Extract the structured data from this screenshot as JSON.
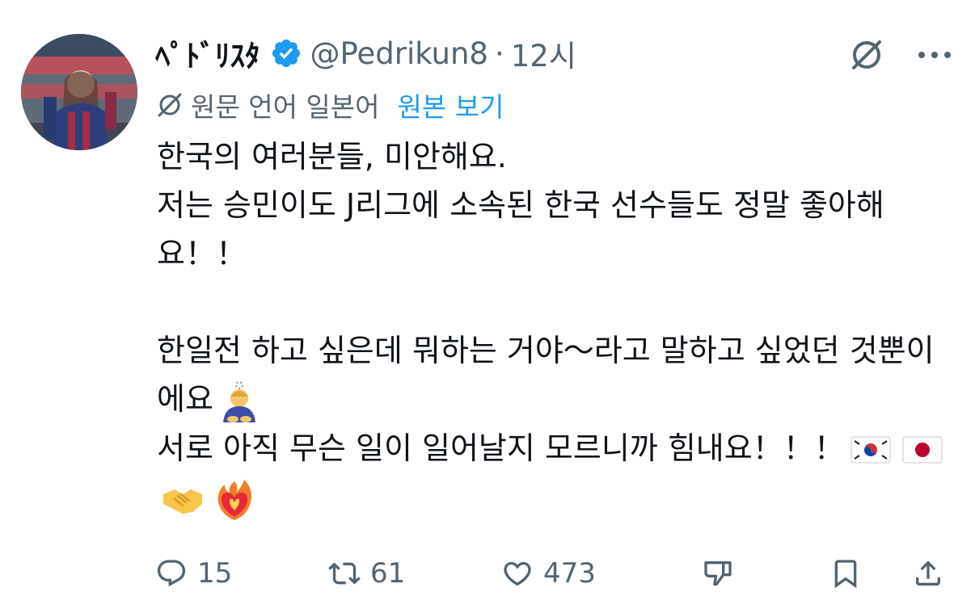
{
  "author": {
    "display_name": "ﾍﾟﾄﾞﾘｽﾀ",
    "handle": "@Pedrikun8",
    "separator": "·",
    "time": "12시",
    "verified": true
  },
  "header_icons": [
    "grok-icon",
    "more-icon"
  ],
  "translation": {
    "notice": "원문 언어 일본어",
    "show_original": "원본 보기"
  },
  "tweet": {
    "line1": "한국의 여러분들, 미안해요.",
    "line2": "저는 승민이도 J리그에 소속된 한국 선수들도 정말 좋아해요！！",
    "line3": "한일전 하고 싶은데 뭐하는 거야～라고 말하고 싶었던 것뿐이에요",
    "line4": "서로 아직 무슨 일이 일어날지 모르니까 힘내요！！！",
    "emojis_line3": [
      "person-bowing-emoji"
    ],
    "emojis_line4": [
      "flag-korea-emoji",
      "flag-japan-emoji",
      "handshake-emoji",
      "heart-on-fire-emoji"
    ]
  },
  "actions": {
    "replies": "15",
    "reposts": "61",
    "likes": "473"
  },
  "colors": {
    "text": "#0f1419",
    "secondary": "#536471",
    "accent": "#1d9bf0"
  }
}
